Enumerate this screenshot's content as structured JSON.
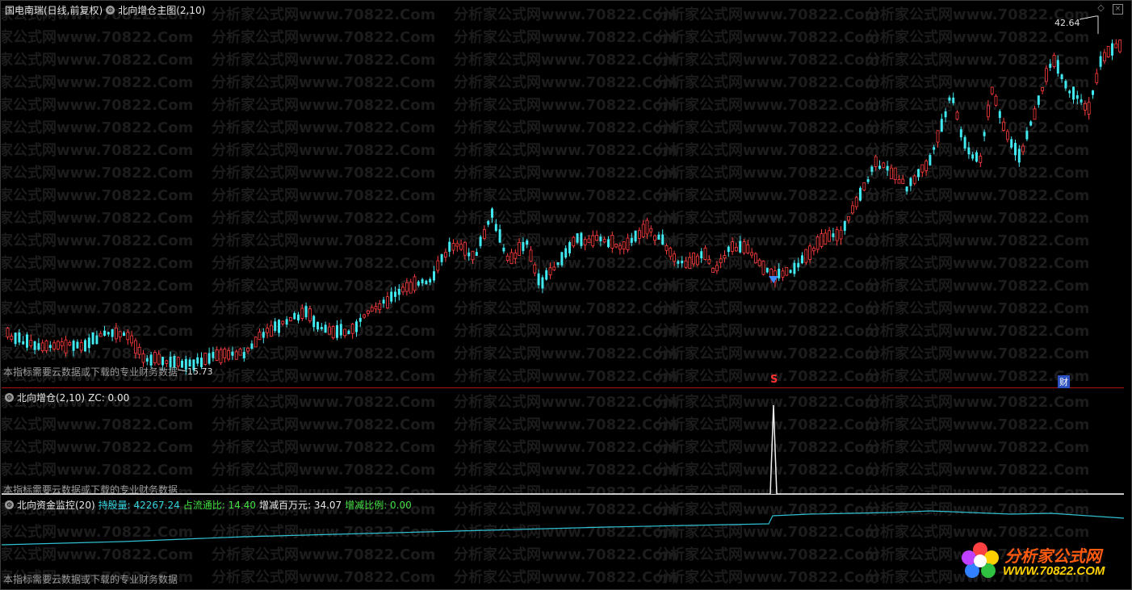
{
  "main": {
    "stock_title": "国电南瑞(日线,前复权)",
    "indicator_name": "北向增仓主图(2,10)",
    "note": "本指标需要云数据或下载的专业财务数据",
    "high_label": "42.64",
    "low_label": "15.73",
    "signal_mark": "S",
    "finance_mark": "财",
    "colors": {
      "up": "#ff3c3c",
      "down": "#40e8f0",
      "arrow": "#3c8cff"
    },
    "price_range": [
      15.73,
      42.64
    ]
  },
  "mid": {
    "indicator_name": "北向增仓(2,10)",
    "zc_label": "ZC: 0.00",
    "note": "本指标需要云数据或下载的专业财务数据"
  },
  "bottom": {
    "indicator_name": "北向资金监控(20)",
    "holdings_label": "持股量: 42267.24",
    "ratio_label": "占流通比: 14.40",
    "change_label": "增减百万元: 34.07",
    "pct_label": "增减比例: 0.00",
    "note": "本指标需要云数据或下载的专业财务数据",
    "line_color": "#30c0d0"
  },
  "watermark": {
    "text": "分析家公式网www.70822.Com"
  },
  "logo": {
    "title": "分析家公式网",
    "url": "WWW.70822.COM"
  },
  "controls": {
    "diamond_icon": "◇",
    "close_icon": "×"
  }
}
